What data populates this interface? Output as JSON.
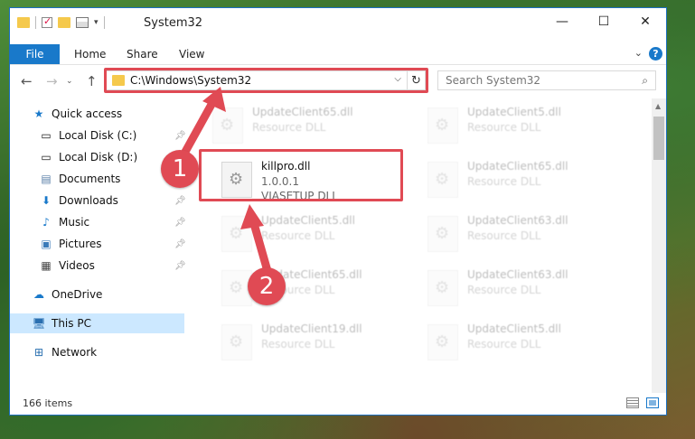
{
  "window": {
    "title": "System32",
    "controls": {
      "minimize": "—",
      "maximize": "☐",
      "close": "✕"
    }
  },
  "ribbon": {
    "file": "File",
    "tabs": [
      "Home",
      "Share",
      "View"
    ],
    "help": "?"
  },
  "nav": {
    "address": "C:\\Windows\\System32",
    "search_placeholder": "Search System32"
  },
  "sidebar": {
    "items": [
      {
        "label": "Quick access",
        "icon": "star-icon"
      },
      {
        "label": "Local Disk (C:)",
        "icon": "drive-icon",
        "pinned": true
      },
      {
        "label": "Local Disk (D:)",
        "icon": "drive-icon"
      },
      {
        "label": "Documents",
        "icon": "documents-icon",
        "pinned": true
      },
      {
        "label": "Downloads",
        "icon": "download-icon",
        "pinned": true
      },
      {
        "label": "Music",
        "icon": "music-icon",
        "pinned": true
      },
      {
        "label": "Pictures",
        "icon": "pictures-icon",
        "pinned": true
      },
      {
        "label": "Videos",
        "icon": "videos-icon",
        "pinned": true
      },
      {
        "label": "OneDrive",
        "icon": "cloud-icon"
      },
      {
        "label": "This PC",
        "icon": "computer-icon",
        "selected": true
      },
      {
        "label": "Network",
        "icon": "network-icon"
      }
    ]
  },
  "files": {
    "highlighted": {
      "name": "killpro.dll",
      "version": "1.0.0.1",
      "desc": "VIASETUP DLL"
    },
    "others": [
      {
        "name": "UpdateClient65.dll",
        "desc": "Resource DLL"
      },
      {
        "name": "UpdateClient5.dll",
        "desc": "Resource DLL"
      },
      {
        "name": "UpdateClient65.dll",
        "desc": "Resource DLL"
      },
      {
        "name": "UpdateClient5.dll",
        "desc": "Resource DLL"
      },
      {
        "name": "UpdateClient63.dll",
        "desc": "Resource DLL"
      },
      {
        "name": "UpdateClient65.dll",
        "desc": "Resource DLL"
      },
      {
        "name": "UpdateClient63.dll",
        "desc": "Resource DLL"
      },
      {
        "name": "UpdateClient19.dll",
        "desc": "Resource DLL"
      },
      {
        "name": "UpdateClient5.dll",
        "desc": "Resource DLL"
      }
    ]
  },
  "status": {
    "count": "166 items"
  },
  "callouts": [
    "1",
    "2"
  ],
  "colors": {
    "accent": "#1979ca",
    "highlight": "#e04a54",
    "selected": "#cce8ff"
  }
}
